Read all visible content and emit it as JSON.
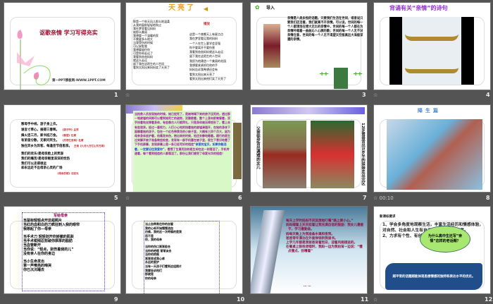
{
  "slides": [
    {
      "number": "1",
      "title": "讴歌亲情 学习写得充实",
      "footer": "第一PPT模板网-WWW.1PPT.COM"
    },
    {
      "number": "2",
      "title": "天亮了",
      "audio_label": "播放",
      "left_lines": [
        "那是一个秋天风儿那么地温柔",
        "从我的窗前轻轻地吹过",
        "我在梦里看见妈妈",
        "她那么美丽",
        "我想要一个温暖的家",
        "不需要多么地大",
        "当我受伤的时候",
        "可以安慰我",
        "我想要留住你",
        "可是你却走远了",
        "我看到爸爸妈妈",
        "就这么走远",
        "留下我在这陌生的人世间",
        "看到太阳出来妈妈笑了天亮了"
      ],
      "right_lines": [
        "这是一个夜晚天上有星点点",
        "我在梦里看见我的妈妈",
        "一个人在世上要学会坚强",
        "你不要离开不要伤害",
        "我看到爸爸妈妈就这么走远",
        "留下我在这陌生的人世间",
        "我愿为他建造一个美丽的花园",
        "我想要紧紧抓住他的手",
        "妈妈告诉我希望还会有",
        "看到太阳出来天亮了",
        "看到太阳出来他们笑了天亮了"
      ]
    },
    {
      "number": "3",
      "title": "导入",
      "body": "亲情是人类永恒的话题。只要我们生活在世间，或者说只要我们还活着，我们就离不开亲情。可以说，世间的每一个人都浸泡在博大无比的亲情中，世间的每一个人都在为亲情吟唱着一曲曲沁人心脾的歌；世间的每一个人无不对亲情在意，世间的每一个人无不渴望天空般高远大海般深邃的亲情。"
    },
    {
      "number": "4",
      "title": "背诵有关“亲情”的诗句"
    },
    {
      "number": "5",
      "lines": [
        {
          "text": "慈母手中线，游子身上衣。",
          "src": ""
        },
        {
          "text": "谁言寸草心，报得三春晖。",
          "src": "《游子吟》孟郊"
        },
        {
          "text": "烽火连三月，家书抵万金。",
          "src": "《春望》杜甫"
        },
        {
          "text": "有弟皆分散，无家问死生。",
          "src": "《月夜忆舍弟》杜甫"
        },
        {
          "text": "独在异乡为异客，每逢佳节倍思亲。",
          "src": "王维《九月九日忆山东兄弟》"
        }
      ],
      "poem": [
        "我们的欢乐/是母亲脸上的笑容",
        "我们的痛苦/是母亲眼里深深的忧伤",
        "我们可以走得很远",
        "却永远走不出母亲心灵的广场"
      ],
      "poem_src": "《母亲的眼》沈宏光"
    },
    {
      "number": "6",
      "body": "当抢救人员发现她的时候，她已经死了，是被垮塌下来的房子压死的，透过那一堆废墟的间隙可以看到她死亡的姿势，双膝跪着，整个上身向前匍匐着，双手扶着地支撑着身体，有些像古人行跪拜礼，只是身体被压得变形了，看上去有些诡异。经过一番努力，人们小心地把挡着她的废墟清理开，在她的身体下面躺着她的孩子，包在一个红色带黄花的小被子里，大概有三四个月大，因为母亲身体庇护着，他毫发未伤，抱出来的时候，他还安静地睡着。随行的医生过来解开被子准备做些检查，发现有一部手机塞在被子里，医生下意识地看了下手机屏幕，发现屏幕上是一条已经写好的短信",
      "highlight": "“亲爱的宝贝，如果你能活着，一定要记住我爱你”",
      "tail": "，看惯了生离死别的医生却在这一刻落泪了，手机传递着，每个看到短信的人都落泪了。那份让我们感受了母爱光华的短信！"
    },
    {
      "number": "7",
      "left_caption": "父亲徒步背出遇难的女儿",
      "right_caption": "12岁哥哥背出5岁半的妹妹走出灾区"
    },
    {
      "number": "8",
      "title": "降生篇",
      "timing": "00:10"
    },
    {
      "number": "9",
      "title": "写给母亲",
      "stanzas": [
        [
          "当鼠标轻轻点开这组照片",
          "当红的血和白的刀疯狂刺入我的眼帘",
          "我想起了你—母亲"
        ],
        [
          "当手术刀 轻轻划开你娇嫩的肌肤",
          "当手术钳残忍剪破你厚厚的脂肪",
          "当血管断开",
          "当你说：“轻点，别伤着我的儿”",
          "没有亲人在你的身边"
        ],
        [
          "当小生命发出",
          "第一声嘹亮的啼哭",
          "你已沉沉睡去"
        ]
      ]
    },
    {
      "number": "10",
      "stanzas": [
        [
          "当止血带勇往你的血管",
          "我的心却开始慢慢流血",
          "仿佛，我的这一次呼痛的是我",
          "而不是",
          "你，我的母亲"
        ],
        [
          "当你的伤口渐渐愈合",
          "当你的疤痕 渐渐淡去",
          "当你的疤痕",
          "渐渐变成我心疼",
          "永远的爱护",
          "当有一天孩子们看到这组照片",
          "我要告诉他们",
          "那就是",
          "你的母亲"
        ]
      ]
    },
    {
      "number": "11",
      "bullets": [
        "每天上学时妈妈不厌其烦地叮嘱“路上要小心。”",
        "妈妈端着上天天挂着让我充满自信的鼓励：我女儿最能干，学习最勤奋。",
        "妈每天晚上为我准备水果和夜宵。",
        "爸爸常年漂泊在外面挣钱供我读书。",
        "上学几年都是我爸爸背着烈日，迎着风雨接送的。",
        "在餐桌上狼吞虎咽时，我妈一边为我拍背一边说：“慢点慢点，别噎着”"
      ],
      "ellipsis": "… …"
    },
    {
      "number": "12",
      "heading": "新课标要求",
      "items": [
        "1、学会多角度地观察生活，丰富生活经历和情感体验，对自然、社会和人生有自己独特的感受和思考。",
        "2、力求有个性、有创意的表达。"
      ],
      "bubble": "为什么高中生还写”亲情”这样的老话题？",
      "banner": "越平常的话题越能体现思想情感的独特和表达水平的优劣。"
    }
  ],
  "transition_icon": "star-transition-icon"
}
